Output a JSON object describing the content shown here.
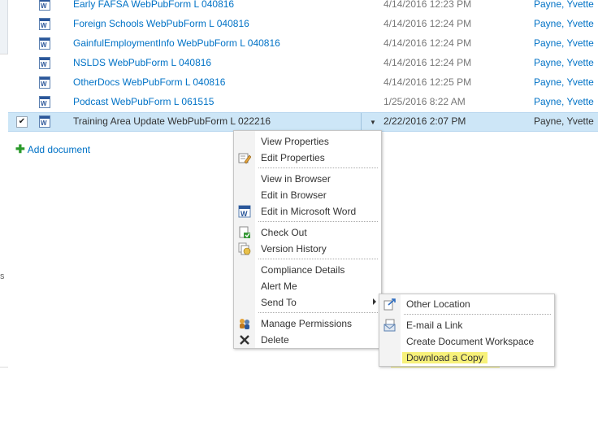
{
  "documents": [
    {
      "name": "Early FAFSA WebPubForm L 040816",
      "modified": "4/14/2016 12:23 PM",
      "modified_by": "Payne, Yvette"
    },
    {
      "name": "Foreign Schools WebPubForm L 040816",
      "modified": "4/14/2016 12:24 PM",
      "modified_by": "Payne, Yvette"
    },
    {
      "name": "GainfulEmploymentInfo WebPubForm L 040816",
      "modified": "4/14/2016 12:24 PM",
      "modified_by": "Payne, Yvette"
    },
    {
      "name": "NSLDS WebPubForm L 040816",
      "modified": "4/14/2016 12:24 PM",
      "modified_by": "Payne, Yvette"
    },
    {
      "name": "OtherDocs WebPubForm L 040816",
      "modified": "4/14/2016 12:25 PM",
      "modified_by": "Payne, Yvette"
    },
    {
      "name": "Podcast WebPubForm L 061515",
      "modified": "1/25/2016 8:22 AM",
      "modified_by": "Payne, Yvette"
    },
    {
      "name": "Training Area Update WebPubForm L 022216",
      "modified": "2/22/2016 2:07 PM",
      "modified_by": "Payne, Yvette",
      "selected": true
    }
  ],
  "selected_checkmark": "✔",
  "add_document": "Add document",
  "left_edge_char": "s",
  "context_menu": {
    "items": [
      {
        "label": "View Properties",
        "icon": "none"
      },
      {
        "label": "Edit Properties",
        "icon": "edit-properties-icon"
      },
      {
        "label": "View in Browser",
        "icon": "none"
      },
      {
        "label": "Edit in Browser",
        "icon": "none"
      },
      {
        "label": "Edit in Microsoft Word",
        "icon": "word-icon"
      },
      {
        "label": "Check Out",
        "icon": "check-out-icon"
      },
      {
        "label": "Version History",
        "icon": "version-history-icon"
      },
      {
        "label": "Compliance Details",
        "icon": "none"
      },
      {
        "label": "Alert Me",
        "icon": "none"
      },
      {
        "label": "Send To",
        "icon": "none",
        "has_submenu": true
      },
      {
        "label": "Manage Permissions",
        "icon": "permissions-icon"
      },
      {
        "label": "Delete",
        "icon": "delete-icon"
      }
    ]
  },
  "send_to_submenu": {
    "items": [
      {
        "label": "Other Location",
        "icon": "other-location-icon"
      },
      {
        "label": "E-mail a Link",
        "icon": "email-link-icon"
      },
      {
        "label": "Create Document Workspace",
        "icon": "none"
      },
      {
        "label": "Download a Copy",
        "icon": "none",
        "highlighted": true
      }
    ]
  },
  "colors": {
    "link": "#0072c6",
    "selected_row": "#cde6f7",
    "highlight": "#f7f17a"
  }
}
